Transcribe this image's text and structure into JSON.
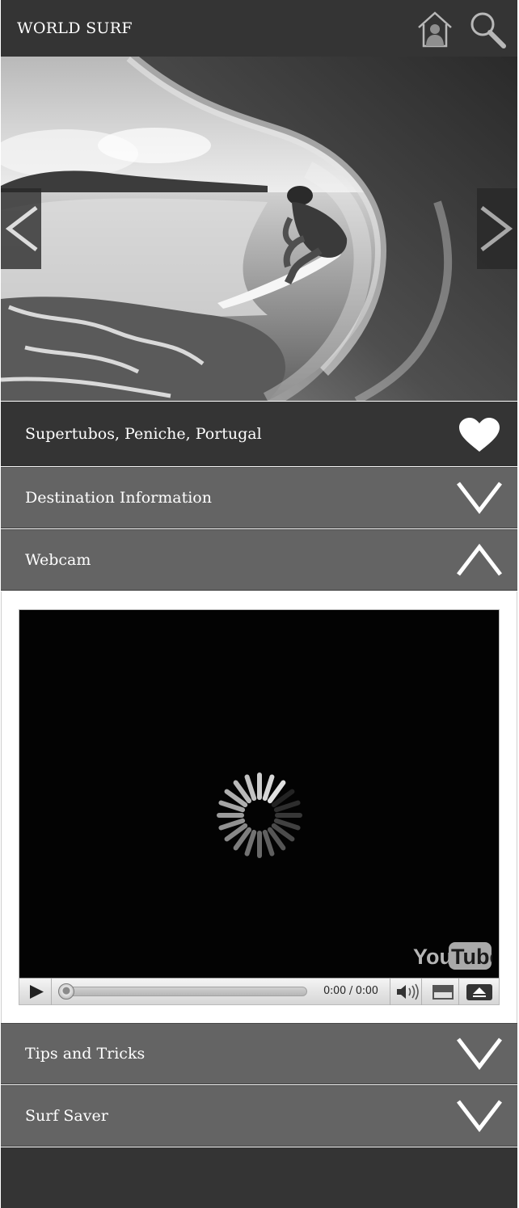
{
  "header": {
    "title": "WORLD SURF",
    "icons": {
      "profile": "home-user-icon",
      "search": "search-icon"
    }
  },
  "hero": {
    "image": "surfer-in-barrel-wave-photo",
    "prev_icon": "chevron-left-icon",
    "next_icon": "chevron-right-icon"
  },
  "location": {
    "name": "Supertubos, Peniche, Portugal",
    "favorite_icon": "heart-icon"
  },
  "sections": [
    {
      "label": "Destination Information",
      "expanded": false,
      "icon": "chevron-down-icon"
    },
    {
      "label": "Webcam",
      "expanded": true,
      "icon": "chevron-up-icon"
    },
    {
      "label": "Tips and Tricks",
      "expanded": false,
      "icon": "chevron-down-icon"
    },
    {
      "label": "Surf Saver",
      "expanded": false,
      "icon": "chevron-down-icon"
    }
  ],
  "webcam": {
    "player": {
      "time": "0:00 / 0:00",
      "progress_fraction": 0,
      "loading": true,
      "logo_text": {
        "you": "You",
        "tube": "Tube"
      }
    }
  },
  "colors": {
    "dark_bar": "#343434",
    "section_bar": "#646464",
    "text": "#ffffff"
  }
}
